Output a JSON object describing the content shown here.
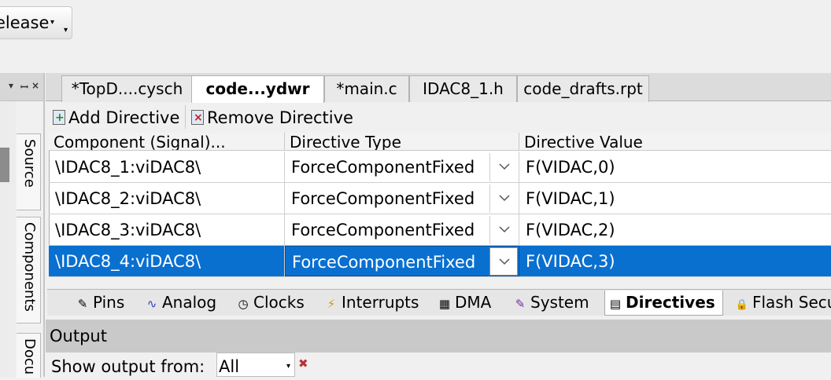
{
  "toolbar": {
    "configuration": "elease"
  },
  "left_panel": {
    "header_icons": [
      "▾",
      "ꟷ",
      "×"
    ],
    "vertical_tabs": [
      "Source",
      "Components",
      "Docu"
    ]
  },
  "doc_tabs": [
    {
      "label": "*TopD....cysch",
      "active": false
    },
    {
      "label": "code...ydwr",
      "active": true
    },
    {
      "label": "*main.c",
      "active": false
    },
    {
      "label": "IDAC8_1.h",
      "active": false
    },
    {
      "label": "code_drafts.rpt",
      "active": false
    }
  ],
  "directive_toolbar": {
    "add_label": "Add Directive",
    "remove_label": "Remove Directive"
  },
  "grid": {
    "columns": [
      "Component (Signal)...",
      "Directive Type",
      "Directive Value"
    ],
    "rows": [
      {
        "component": "\\IDAC8_1:viDAC8\\",
        "type": "ForceComponentFixed",
        "value": "F(VIDAC,0)",
        "selected": false
      },
      {
        "component": "\\IDAC8_2:viDAC8\\",
        "type": "ForceComponentFixed",
        "value": "F(VIDAC,1)",
        "selected": false
      },
      {
        "component": "\\IDAC8_3:viDAC8\\",
        "type": "ForceComponentFixed",
        "value": "F(VIDAC,2)",
        "selected": false
      },
      {
        "component": "\\IDAC8_4:viDAC8\\",
        "type": "ForceComponentFixed",
        "value": "F(VIDAC,3)",
        "selected": true
      }
    ],
    "selection_color": "#0a70d0"
  },
  "bottom_tabs": [
    {
      "label": "Pins",
      "icon": "pins-icon",
      "glyph": "✎"
    },
    {
      "label": "Analog",
      "icon": "analog-icon",
      "glyph": "∿"
    },
    {
      "label": "Clocks",
      "icon": "clock-icon",
      "glyph": "◷"
    },
    {
      "label": "Interrupts",
      "icon": "lightning-icon",
      "glyph": "⚡"
    },
    {
      "label": "DMA",
      "icon": "dma-icon",
      "glyph": "▦"
    },
    {
      "label": "System",
      "icon": "system-icon",
      "glyph": "✎"
    },
    {
      "label": "Directives",
      "icon": "directives-icon",
      "glyph": "▤",
      "active": true
    },
    {
      "label": "Flash Secu",
      "icon": "lock-icon",
      "glyph": "🔒"
    }
  ],
  "output": {
    "title": "Output",
    "show_from_label": "Show output from:",
    "show_from_value": "All"
  }
}
